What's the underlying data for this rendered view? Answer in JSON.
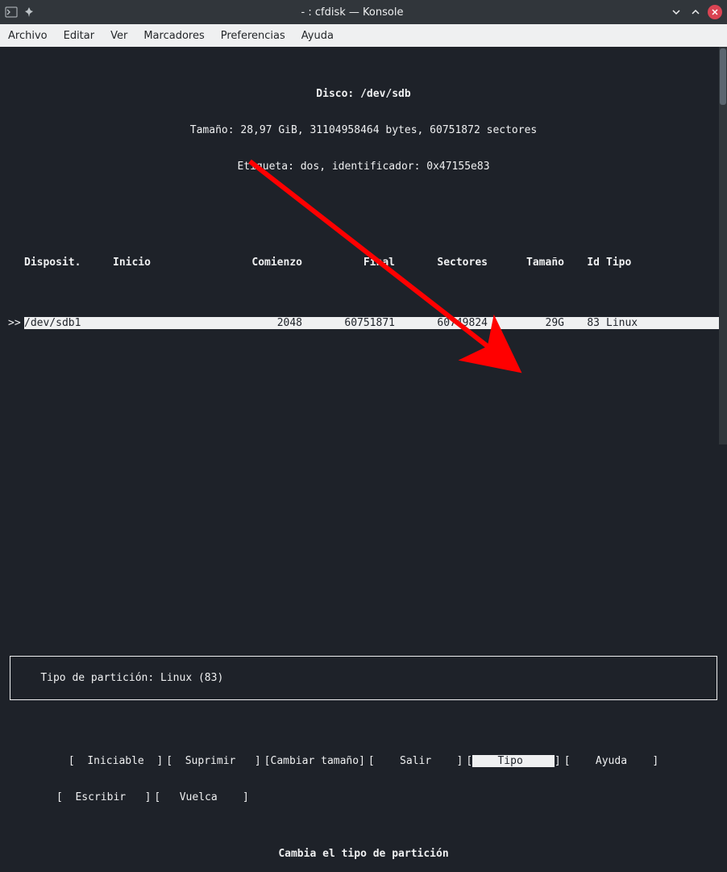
{
  "titlebar": {
    "title": "- : cfdisk — Konsole"
  },
  "menubar": {
    "archivo": "Archivo",
    "editar": "Editar",
    "ver": "Ver",
    "marcadores": "Marcadores",
    "preferencias": "Preferencias",
    "ayuda": "Ayuda"
  },
  "disk": {
    "label": "Disco: /dev/sdb",
    "size_line": "Tamaño: 28,97 GiB, 31104958464 bytes, 60751872 sectores",
    "label_line": "Etiqueta: dos, identificador: 0x47155e83"
  },
  "headers": {
    "device": "Disposit.",
    "boot": "Inicio",
    "start": "Comienzo",
    "end": "Final",
    "sectors": "Sectores",
    "size": "Tamaño",
    "id": "Id",
    "type": "Tipo"
  },
  "row0": {
    "marker": ">>",
    "device": "/dev/sdb1",
    "boot": "",
    "start": "2048",
    "end": "60751871",
    "sectors": "60749824",
    "size": "29G",
    "id": "83",
    "type": "Linux"
  },
  "info": {
    "text": "Tipo de partición: Linux (83)"
  },
  "buttons": {
    "iniciable": "Iniciable",
    "suprimir": "Suprimir",
    "cambiar": "Cambiar tamaño",
    "salir": "Salir",
    "tipo": "Tipo",
    "ayuda": "Ayuda",
    "escribir": "Escribir",
    "vuelca": "Vuelca"
  },
  "tip": "Cambia el tipo de partición"
}
